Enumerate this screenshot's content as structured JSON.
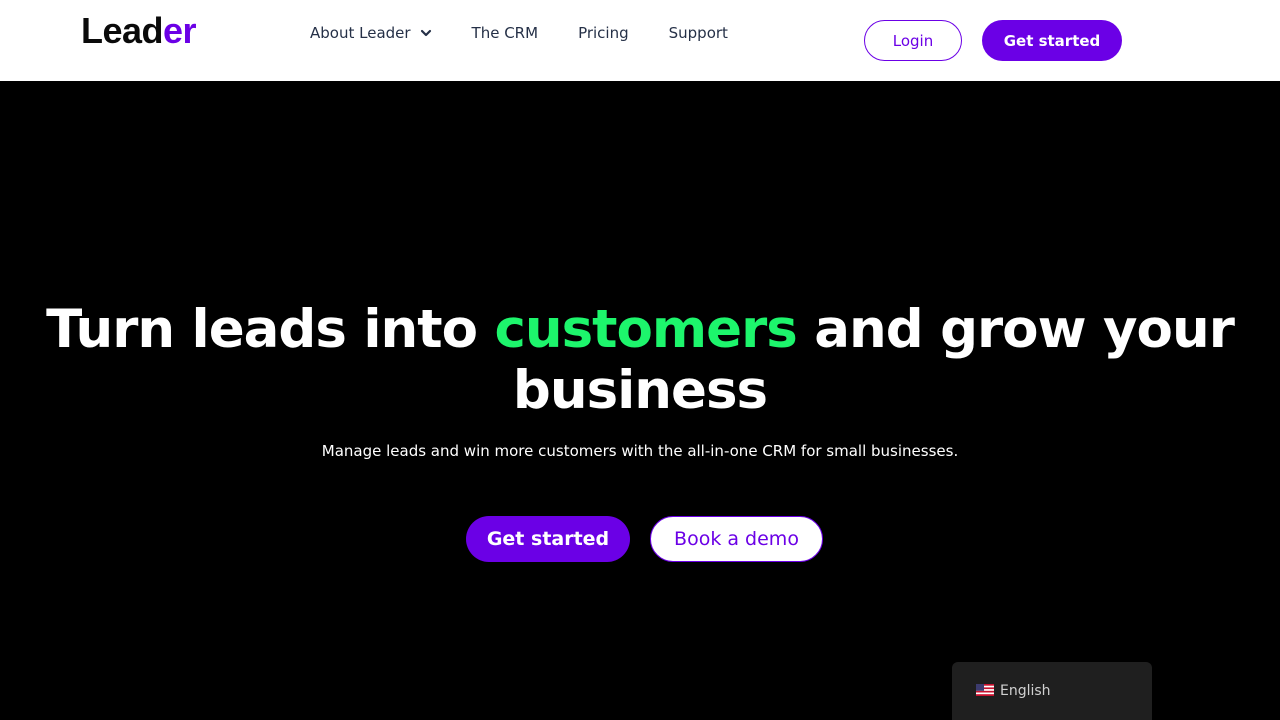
{
  "header": {
    "logo": {
      "part1": "Lead",
      "part2": "er"
    },
    "nav": [
      {
        "label": "About Leader",
        "icon": "chevron-down-icon"
      },
      {
        "label": "The CRM"
      },
      {
        "label": "Pricing"
      },
      {
        "label": "Support"
      }
    ],
    "login_label": "Login",
    "get_started_label": "Get started"
  },
  "hero": {
    "headline_part1": "Turn leads into ",
    "headline_highlight": "customers",
    "headline_part2": " and grow your business",
    "subtitle": "Manage leads and win more customers with the all-in-one CRM for small businesses.",
    "primary_cta": "Get started",
    "secondary_cta": "Book a demo"
  },
  "language_switcher": {
    "icon": "us-flag-icon",
    "label": "English"
  },
  "colors": {
    "brand": "#6b00e6",
    "highlight": "#1df56c",
    "hero_bg": "#000000",
    "nav_text": "#253047"
  }
}
